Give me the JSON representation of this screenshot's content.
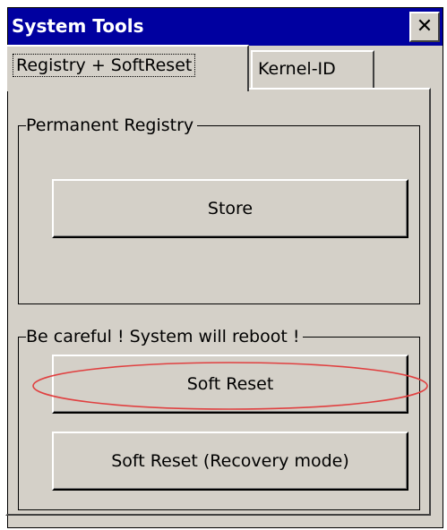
{
  "window": {
    "title": "System Tools",
    "close_glyph": "✕"
  },
  "tabs": [
    {
      "label": "Registry + SoftReset",
      "selected": true
    },
    {
      "label": "Kernel-ID",
      "selected": false
    }
  ],
  "groups": {
    "permanent_registry": {
      "title": "Permanent Registry",
      "store_label": "Store"
    },
    "reboot": {
      "title": "Be careful ! System will reboot !",
      "soft_reset_label": "Soft Reset",
      "recovery_label": "Soft Reset (Recovery mode)"
    }
  },
  "colors": {
    "titlebar": "#0000a0",
    "face": "#d4d0c8",
    "highlight_ellipse": "#e04040"
  },
  "icons": {
    "close": "close-icon"
  }
}
